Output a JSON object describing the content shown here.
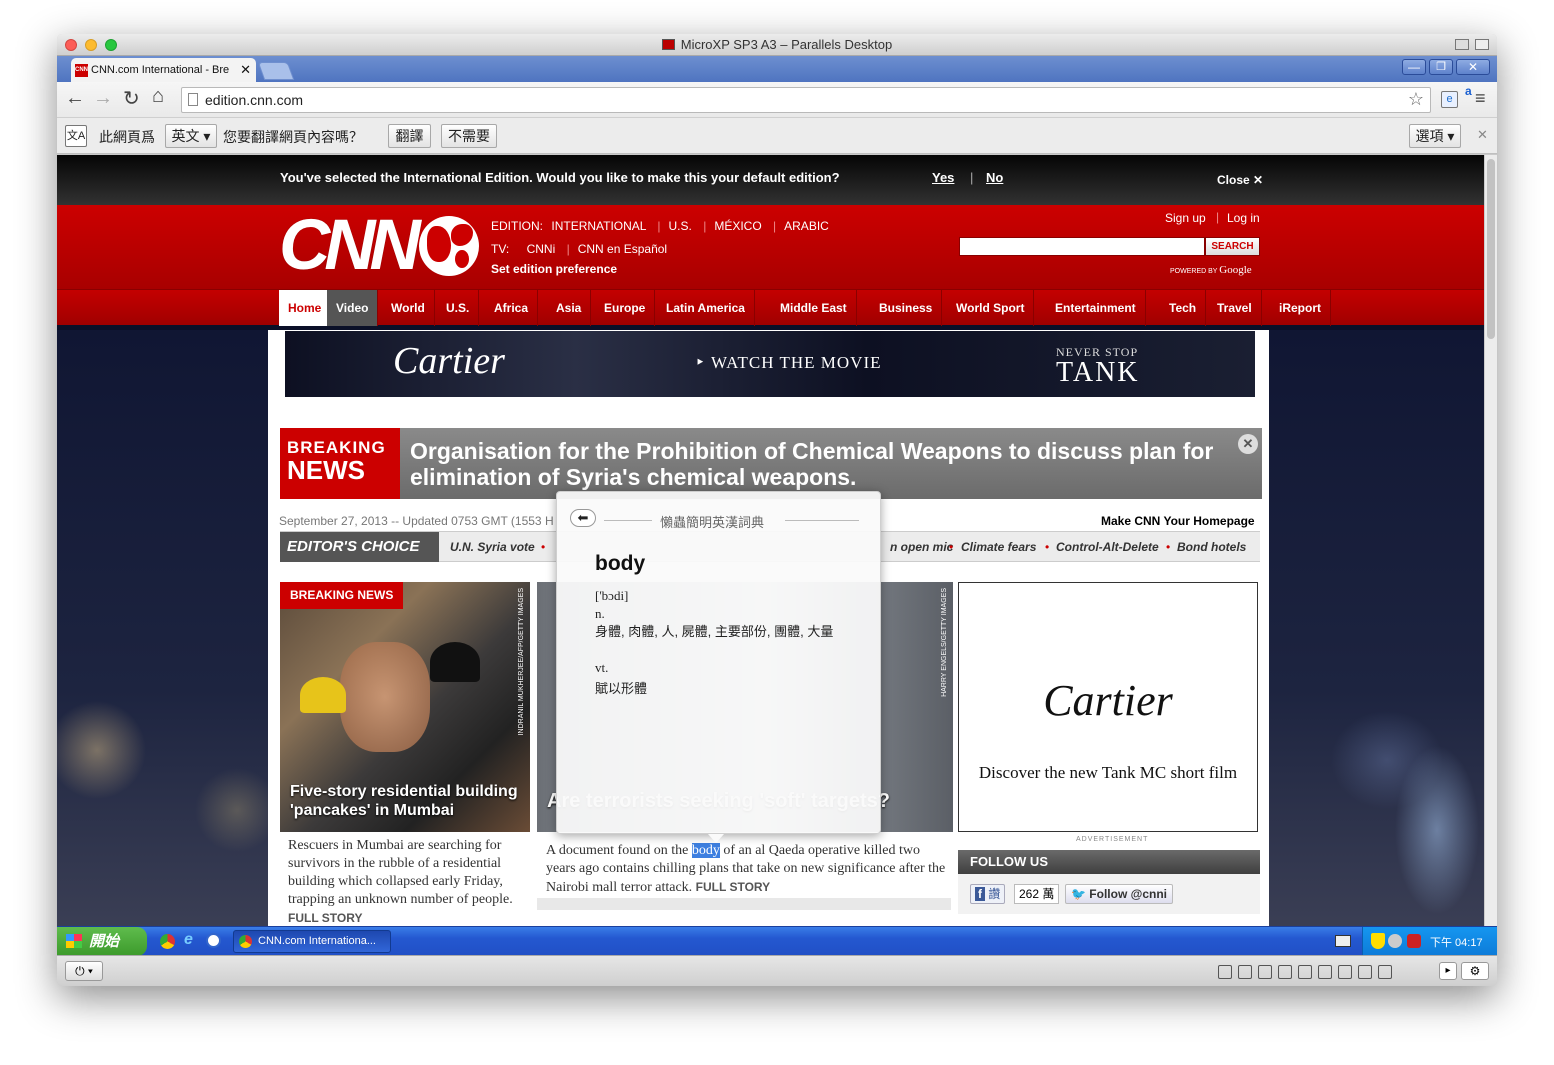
{
  "mac_window": {
    "title": "MicroXP SP3 A3 – Parallels Desktop"
  },
  "browser": {
    "tab_title": "CNN.com International - Bre",
    "url": "edition.cnn.com",
    "translate_bar": {
      "prefix": "此網頁爲",
      "language": "英文",
      "question": "您要翻譯網頁內容嗎？",
      "translate_button": "翻譯",
      "no_button": "不需要",
      "options_button": "選項"
    }
  },
  "cnn": {
    "banner": {
      "message": "You've selected the International Edition. Would you like to make this your default edition?",
      "yes": "Yes",
      "separator": "|",
      "no": "No",
      "close": "Close"
    },
    "header": {
      "logo_text": "CNN",
      "edition_label": "EDITION:",
      "editions": [
        "INTERNATIONAL",
        "U.S.",
        "MÉXICO",
        "ARABIC"
      ],
      "tv_label": "TV:",
      "tv": [
        "CNNi",
        "CNN en Español"
      ],
      "set_pref": "Set edition preference",
      "sign_up": "Sign up",
      "log_in": "Log in",
      "search_button": "SEARCH",
      "powered_by": "POWERED BY",
      "google": "Google"
    },
    "nav": [
      "Home",
      "Video",
      "World",
      "U.S.",
      "Africa",
      "Asia",
      "Europe",
      "Latin America",
      "Middle East",
      "Business",
      "World Sport",
      "Entertainment",
      "Tech",
      "Travel",
      "iReport"
    ],
    "ad_top": {
      "brand": "Cartier",
      "cta": "WATCH THE MOVIE",
      "line1": "NEVER STOP",
      "line2": "TANK"
    },
    "breaking": {
      "label1": "BREAKING",
      "label2": "NEWS",
      "headline": "Organisation for the Prohibition of Chemical Weapons to discuss plan for elimination of Syria's chemical weapons."
    },
    "dateline": "September 27, 2013 -- Updated 0753 GMT (1553 H",
    "make_homepage": "Make CNN Your Homepage",
    "editors_choice": {
      "label": "EDITOR'S CHOICE",
      "items": [
        "U.N. Syria vote",
        "n open mic",
        "Climate fears",
        "Control-Alt-Delete",
        "Bond hotels"
      ]
    },
    "story1": {
      "badge": "BREAKING NEWS",
      "credit": "INDRANIL MUKHERJEE/AFP/GETTY IMAGES",
      "headline": "Five-story residential building 'pancakes' in Mumbai",
      "body": "Rescuers in Mumbai are searching for survivors in the rubble of a residential building which collapsed early Friday, trapping an unknown number of people.",
      "more": "FULL STORY"
    },
    "story2": {
      "credit": "HARRY ENGELS/GETTY IMAGES",
      "headline": "Are terrorists seeking 'soft' targets?",
      "body_before": "A document found on the ",
      "body_highlight": "body",
      "body_after": " of an al Qaeda operative killed two years ago contains chilling plans that take on new significance after the Nairobi mall terror attack.",
      "more": "FULL STORY"
    },
    "ad_side": {
      "brand": "Cartier",
      "tagline": "Discover the new Tank MC short film",
      "label": "ADVERTISEMENT"
    },
    "follow": {
      "title": "FOLLOW US",
      "fb": "讚",
      "fb_count": "262 萬",
      "twitter": "Follow @cnni"
    }
  },
  "dictionary": {
    "title": "懶蟲簡明英漢詞典",
    "word": "body",
    "phonetic": "['bɔdi]",
    "pos1": "n.",
    "def1": "身體, 肉體, 人, 屍體, 主要部份, 團體, 大量",
    "pos2": "vt.",
    "def2": "賦以形體"
  },
  "taskbar": {
    "start": "開始",
    "window": "CNN.com Internationa...",
    "clock": "下午 04:17"
  },
  "colors": {
    "cnn_red": "#cc0000",
    "xp_blue": "#245edb",
    "start_green": "#3c9a2b"
  }
}
